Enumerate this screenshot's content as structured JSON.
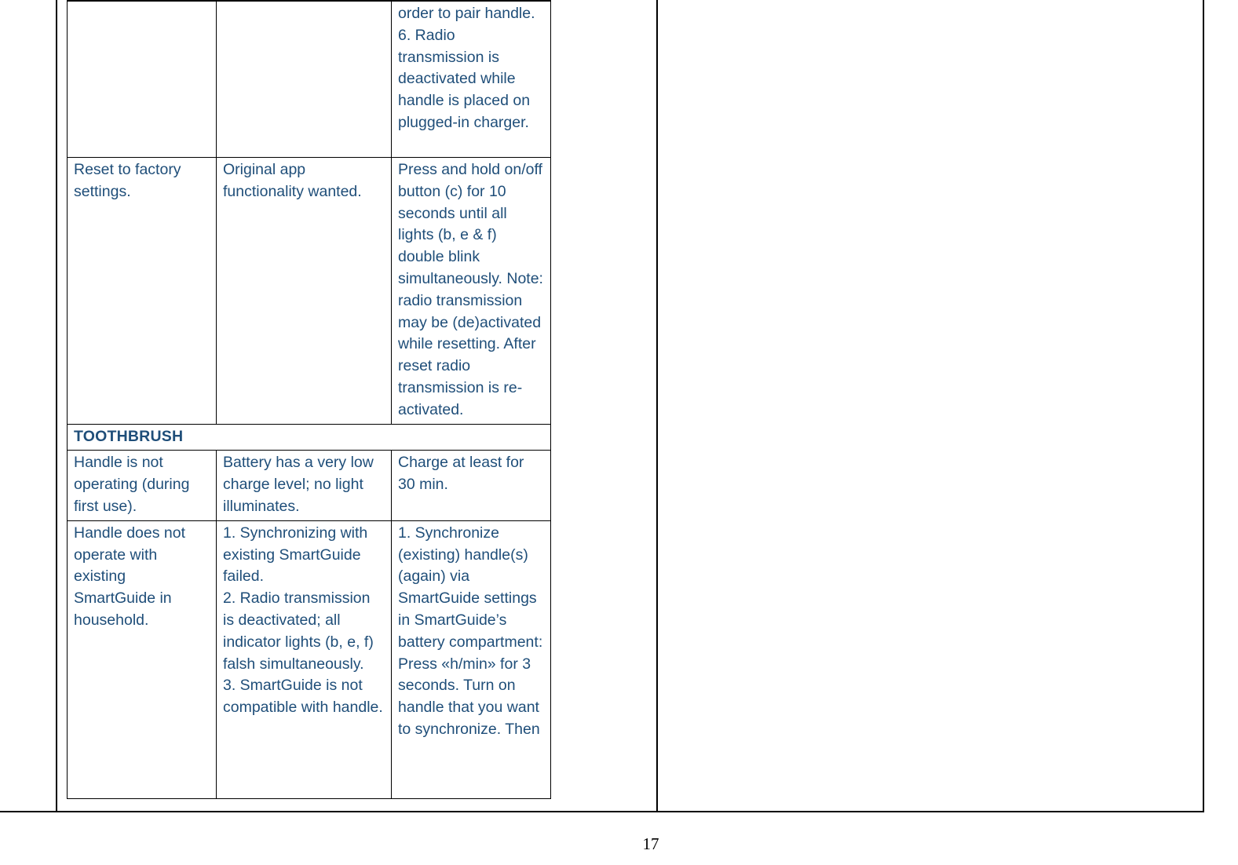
{
  "document": {
    "page_number": "17",
    "text_color": "#1F4E79",
    "border_color": "#000000"
  },
  "table": {
    "rows": [
      {
        "type": "data",
        "clipped_top": true,
        "cells": [
          "",
          "",
          "order to pair handle.\n6. Radio transmission is deactivated while handle is placed on plugged-in charger."
        ]
      },
      {
        "type": "data",
        "cells": [
          "Reset to factory settings.",
          "Original app functionality wanted.",
          "Press and hold on/off button (c) for 10 seconds until all lights (b, e & f) double blink simultaneously. Note: radio transmission may be (de)activated while resetting. After reset radio transmission is re-activated."
        ]
      },
      {
        "type": "section-heading",
        "cells": [
          "TOOTHBRUSH"
        ]
      },
      {
        "type": "data",
        "cells": [
          "Handle is not operating (during first use).",
          "Battery has a very low charge level; no light illuminates.",
          "Charge at least for 30 min."
        ]
      },
      {
        "type": "data",
        "clipped_bottom": true,
        "cells": [
          "Handle does not operate with existing SmartGuide in household.",
          "1. Synchronizing with existing SmartGuide failed.\n2. Radio transmission is deactivated; all indicator lights (b, e, f) falsh simultaneously.\n3. SmartGuide is not compatible with handle.",
          "1. Synchronize (existing) handle(s) (again)  via SmartGuide settings in SmartGuide’s battery compartment: Press «h/min» for 3 seconds. Turn on handle that you want to synchronize. Then"
        ]
      }
    ]
  }
}
